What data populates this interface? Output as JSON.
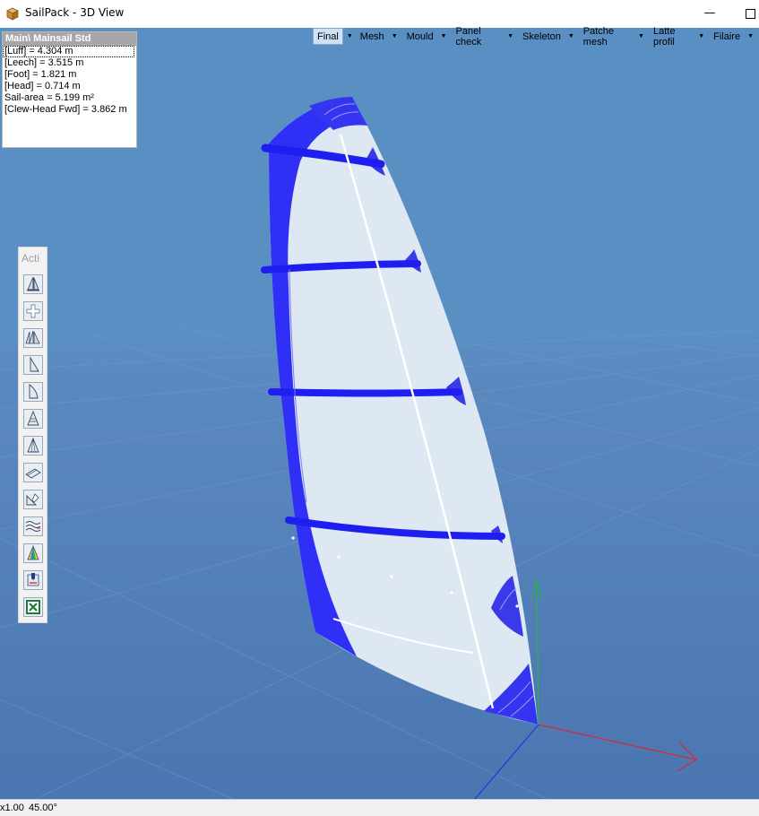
{
  "window": {
    "title": "SailPack - 3D View",
    "minimize_glyph": "—",
    "maximize_glyph": ""
  },
  "view_tabs": [
    {
      "label": "Final",
      "active": true,
      "has_dropdown": true
    },
    {
      "label": "Mesh",
      "active": false,
      "has_dropdown": true
    },
    {
      "label": "Mould",
      "active": false,
      "has_dropdown": true
    },
    {
      "label": "Panel check",
      "active": false,
      "has_dropdown": true
    },
    {
      "label": "Skeleton",
      "active": false,
      "has_dropdown": true
    },
    {
      "label": "Patche mesh",
      "active": false,
      "has_dropdown": true
    },
    {
      "label": "Latte profil",
      "active": false,
      "has_dropdown": true
    },
    {
      "label": "Filaire",
      "active": false,
      "has_dropdown": true
    }
  ],
  "info_panel": {
    "header": "Main\\ Mainsail Std",
    "rows": [
      "[Luff] = 4.304 m",
      "[Leech] = 3.515 m",
      "[Foot] = 1.821 m",
      "[Head] = 0.714 m",
      "Sail-area = 5.199 m²",
      "[Clew-Head Fwd] = 3.862 m"
    ]
  },
  "actions_toolbar": {
    "title": "Acti",
    "tools": [
      "sail-icon",
      "cross-icon",
      "sails-icon",
      "jib-icon",
      "main-icon",
      "panels-icon",
      "radial-icon",
      "flat-panel-icon",
      "pen-panel-icon",
      "wave-icon",
      "color-sail-icon",
      "tag-icon",
      "excel-icon"
    ]
  },
  "status": {
    "zoom": "x1.00",
    "angle": "45.00°"
  },
  "colors": {
    "sky": "#5a8fc4",
    "sail_cloth": "#dde8f3",
    "sail_blue": "#2f2ff5",
    "batten_blue": "#1e1ef0",
    "axis_x": "#d8283a",
    "axis_y": "#2fae4d",
    "axis_z": "#1a3ad8"
  }
}
